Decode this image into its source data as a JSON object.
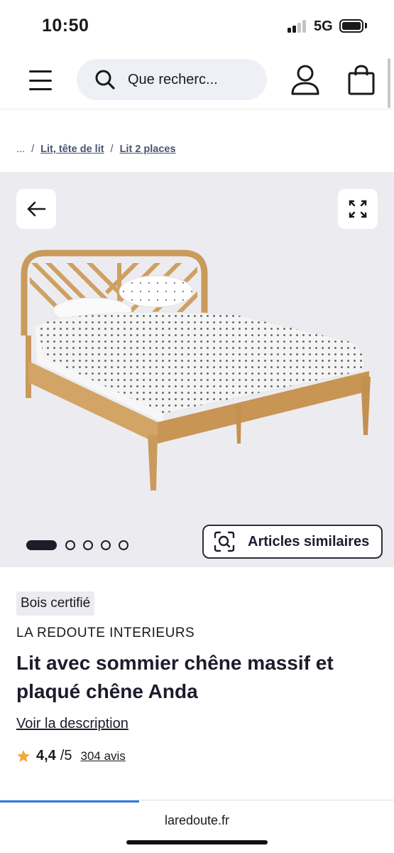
{
  "status_bar": {
    "time": "10:50",
    "network": "5G",
    "icons": [
      "signal-icon",
      "battery-icon"
    ]
  },
  "header": {
    "search_placeholder": "Que recherc...",
    "icons": [
      "menu-icon",
      "search-icon",
      "account-icon",
      "cart-icon"
    ]
  },
  "breadcrumb": {
    "ellipsis": "...",
    "separator": "/",
    "items": [
      {
        "label": "Lit, tête de lit"
      },
      {
        "label": "Lit 2 places"
      }
    ]
  },
  "gallery": {
    "image_count": 5,
    "active_index": 0,
    "similar_label": "Articles similaires",
    "icons": [
      "back-arrow-icon",
      "fullscreen-icon",
      "visual-search-icon"
    ]
  },
  "product": {
    "badge": "Bois certifié",
    "brand": "LA REDOUTE INTERIEURS",
    "title": "Lit avec sommier chêne massif et plaqué chêne Anda",
    "description_link": "Voir la description",
    "rating": {
      "score": "4,4",
      "max": "/5",
      "reviews": "304 avis"
    }
  },
  "browser": {
    "url": "laredoute.fr"
  },
  "colors": {
    "accent_dark": "#1c1c2b",
    "gallery_bg": "#ececf0",
    "search_bg": "#eef0f5",
    "star": "#f2a93b",
    "progress": "#2a7de1"
  }
}
